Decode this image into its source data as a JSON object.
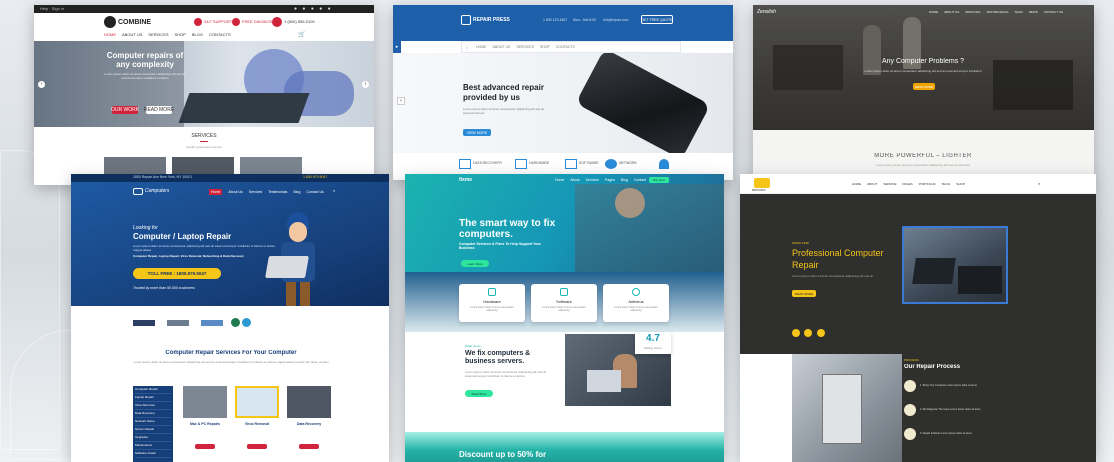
{
  "card1": {
    "logo_text": "COMBINE",
    "topbar_left": "Help · Sign in",
    "info": [
      "24/7 SUPPORT",
      "FREE DIAGNOSTIC",
      "1 (800) 555-0100"
    ],
    "nav": [
      "HOME",
      "ABOUT US",
      "SERVICES",
      "SHOP",
      "BLOG",
      "CONTACTS"
    ],
    "hero_title": "Computer repairs of any complexity",
    "hero_text": "Lorem ipsum dolor sit amet consectetur adipiscing elit sed do eiusmod tempor incididunt ut labore",
    "btn_primary": "OUR WORK",
    "btn_secondary": "READ MORE",
    "section_title": "SERVICES",
    "section_sub": "Quality guaranteed service"
  },
  "card2": {
    "logo_text": "REPAIR PRESS",
    "nav": [
      "HOME",
      "ABOUT US",
      "SERVICES",
      "SHOP",
      "CONTACTS"
    ],
    "contacts": [
      "1 800 123 4567",
      "Mon - Sat 8:00",
      "info@repair.com"
    ],
    "cta": "GET FREE QUOTE",
    "hero_title": "Best advanced repair provided by us",
    "hero_text": "Lorem ipsum dolor sit amet consectetur adipiscing elit sed do eiusmod tempor",
    "btn": "VIEW MORE",
    "features": [
      "DATA RECOVERY",
      "HARDWARE",
      "SOFTWARE",
      "NETWORK"
    ]
  },
  "card3": {
    "logo_text": "Zenolish",
    "nav": [
      "HOME",
      "ABOUT US",
      "SERVICES",
      "TESTIMONIALS",
      "TEAM",
      "NEWS",
      "CONTACT US"
    ],
    "hero_title": "Any Computer Problems ?",
    "hero_text": "Lorem ipsum dolor sit amet consectetur adipiscing elit sed do eiusmod tempor incididunt",
    "btn": "READ MORE",
    "section_title": "MORE POWERFUL – LIGHTER",
    "section_sub": "Lorem ipsum dolor sit amet consectetur adipiscing elit sed do eiusmod"
  },
  "card4": {
    "topbar": "1800 Repair Ave New York, NY 10001",
    "topbar_right": "1 800 979 5047",
    "logo_text": "Computers",
    "nav": [
      "Home",
      "About Us",
      "Services",
      "Testimonials",
      "Blog",
      "Contact Us"
    ],
    "hero_kicker": "Looking for",
    "hero_title": "Computer / Laptop Repair",
    "hero_text": "Lorem ipsum dolor sit amet consectetur adipiscing elit sed do eiusmod tempor incididunt ut labore et dolore magna aliqua",
    "hero_list": "Computer Repair, Laptop Repair, Virus Removal, Networking & Data Recovery",
    "phone": "TOLL FREE : 1800.979.5047",
    "hero_note": "Trusted by more than 50,000 customers",
    "section_title": "Computer Repair Services For Your Computer",
    "section_text": "Lorem ipsum dolor sit amet consectetur adipiscing elit sed do eiusmod tempor incididunt ut labore et dolore magna aliqua ut enim ad minim veniam",
    "sidebar": [
      "Computer Repair",
      "Laptop Repair",
      "Virus Removal",
      "Data Recovery",
      "Network Setup",
      "Screen Repair",
      "Upgrades",
      "Maintenance",
      "Software Install",
      "Consultation"
    ],
    "services": [
      "Mac & PC Repairs",
      "Virus Removal",
      "Data Recovery"
    ]
  },
  "card5": {
    "logo_text": "fixme",
    "nav": [
      "Home",
      "About",
      "Services",
      "Pages",
      "Blog",
      "Contact"
    ],
    "nav_btn": "Buy Now",
    "hero_title": "The smart way to fix computers.",
    "hero_text": "Computer Services & Fixes To Help Support Your Business",
    "btn": "Learn More",
    "features": [
      {
        "title": "Hardware",
        "text": "Lorem ipsum dolor sit amet consectetur adipiscing"
      },
      {
        "title": "Software",
        "text": "Lorem ipsum dolor sit amet consectetur adipiscing"
      },
      {
        "title": "Antivirus",
        "text": "Lorem ipsum dolor sit amet consectetur adipiscing"
      }
    ],
    "kicker": "What we do",
    "section_title": "We fix computers & business servers.",
    "section_text": "Lorem ipsum dolor sit amet consectetur adipiscing elit sed do eiusmod tempor incididunt ut labore et dolore",
    "section_btn": "Read More",
    "rating_value": "4.7",
    "rating_label": "Rating Score",
    "banner": "Discount up to 50% for"
  },
  "card6": {
    "logo_text": "REPAIRIX",
    "nav": [
      "HOME",
      "ABOUT",
      "SERVICE",
      "PAGES",
      "PORTFOLIO",
      "BLOG",
      "SHOP"
    ],
    "kicker": "SINCE 1998",
    "hero_title": "Professional Computer Repair",
    "hero_text": "Lorem ipsum dolor sit amet consectetur adipiscing elit sed do",
    "btn": "READ MORE",
    "process_kicker": "PROCESS",
    "process_title": "Our Repair Process",
    "steps": [
      "1. Bring Your Computer Lorem ipsum dolor sit amet",
      "2. We Diagnose The Issue Lorem ipsum dolor sit amet",
      "3. Repair & Return Lorem ipsum dolor sit amet"
    ]
  },
  "colors": {
    "navy": "#163e78",
    "blue": "#1f66b5",
    "yellow": "#f5c518",
    "teal": "#18b7b1",
    "red": "#d0243c",
    "dark": "#2f2f2d"
  }
}
